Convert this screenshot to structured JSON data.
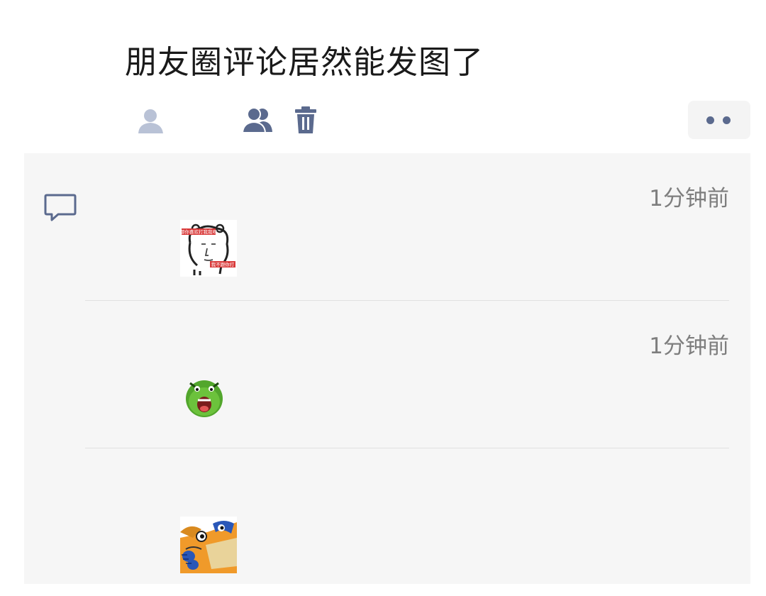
{
  "post": {
    "text": "朋友圈评论居然能发图了"
  },
  "toolbar": {
    "icons": [
      "single-user-icon",
      "group-icon",
      "trash-icon"
    ],
    "more_icon": "more-dots-icon"
  },
  "comments": {
    "section_icon": "comment-bubble-icon",
    "items": [
      {
        "time": "1分钟前",
        "sticker": "bear-meme-sticker",
        "sticker_top_text": "那你喜欢打我我呀",
        "sticker_bottom_text": "我不跟你打"
      },
      {
        "time": "1分钟前",
        "sticker": "green-dinosaur-sticker"
      },
      {
        "time": "",
        "sticker": "cartoon-fox-sticker"
      }
    ]
  },
  "colors": {
    "accent": "#5b6a8e",
    "comment_bg": "#f6f6f6",
    "time_text": "#7e7e7e"
  }
}
